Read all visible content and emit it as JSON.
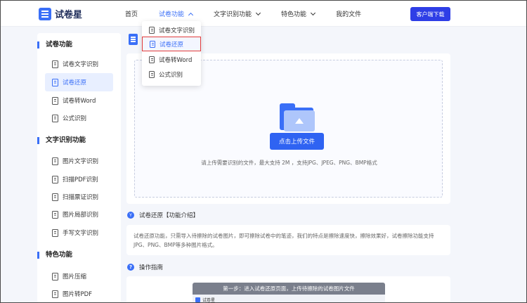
{
  "header": {
    "logo_text": "试卷星",
    "nav": [
      {
        "label": "首页",
        "has_caret": false,
        "active": false
      },
      {
        "label": "试卷功能",
        "has_caret": true,
        "active": true
      },
      {
        "label": "文字识别功能",
        "has_caret": true,
        "active": false
      },
      {
        "label": "特色功能",
        "has_caret": true,
        "active": false
      },
      {
        "label": "我的文件",
        "has_caret": false,
        "active": false
      }
    ],
    "download_label": "客户端下载"
  },
  "dropdown": {
    "items": [
      "试卷文字识别",
      "试卷还原",
      "试卷转Word",
      "公式识别"
    ],
    "highlighted_index": 1
  },
  "sidebar": {
    "sections": [
      {
        "title": "试卷功能",
        "items": [
          "试卷文字识别",
          "试卷还原",
          "试卷转Word",
          "公式识别"
        ]
      },
      {
        "title": "文字识别功能",
        "items": [
          "图片文字识别",
          "扫描PDF识别",
          "扫描票证识别",
          "图片局部识别",
          "手写文字识别"
        ]
      },
      {
        "title": "特色功能",
        "items": [
          "图片压缩",
          "图片转PDF"
        ]
      }
    ],
    "active_item": "试卷还原"
  },
  "upload": {
    "button_label": "点击上传文件",
    "hint": "请上传需要识别的文件，最大支持 2M ，支持JPG、JPEG、PNG、BMP格式"
  },
  "intro": {
    "title": "试卷还原【功能介绍】",
    "text": "试卷还原功能，只需导入待擦除的试卷图片，即可擦除试卷中的笔迹，我们的特点是擦除速度快，擦除效果好，试卷擦除功能支持JPG、PNG、BMP等多种图片格式。"
  },
  "guide": {
    "title": "操作指南",
    "step_title": "第一步：进入试卷还原页面，上传待擦除的试卷图片文件",
    "step_inner_logo": "试卷星"
  },
  "colors": {
    "accent": "#3a6ff7",
    "download_button": "#2e3ee6",
    "highlight_border": "#e23b3b",
    "page_bg": "#f4f6fb"
  }
}
